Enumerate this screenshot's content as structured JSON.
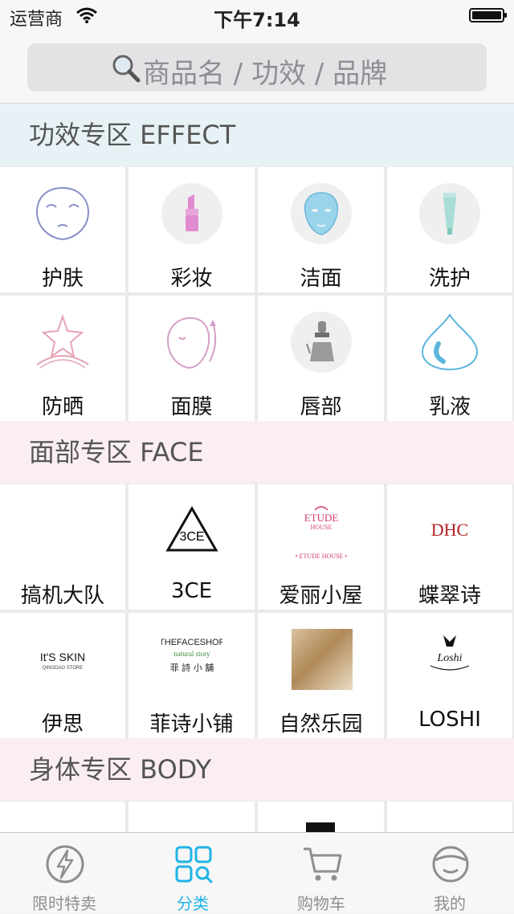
{
  "status": {
    "carrier": "运营商",
    "time": "下午7:14"
  },
  "search": {
    "placeholder": "商品名 / 功效 / 品牌"
  },
  "sections": {
    "effect": {
      "title": "功效专区 EFFECT",
      "items": [
        {
          "label": "护肤",
          "icon": "face-outline-icon"
        },
        {
          "label": "彩妆",
          "icon": "lipstick-icon"
        },
        {
          "label": "洁面",
          "icon": "face-mask-icon"
        },
        {
          "label": "洗护",
          "icon": "tube-icon"
        },
        {
          "label": "防晒",
          "icon": "star-sun-icon"
        },
        {
          "label": "面膜",
          "icon": "face-mask-outline-icon"
        },
        {
          "label": "唇部",
          "icon": "dropper-bottle-icon"
        },
        {
          "label": "乳液",
          "icon": "water-drop-icon"
        }
      ]
    },
    "face": {
      "title": "面部专区 FACE",
      "items": [
        {
          "label": "搞机大队"
        },
        {
          "label": "3CE",
          "logo_text": "3CE"
        },
        {
          "label": "爱丽小屋",
          "logo_text": "ETUDE",
          "logo_sub": "HOUSE",
          "logo_footer": "• ETUDE HOUSE •"
        },
        {
          "label": "蝶翠诗",
          "logo_text": "DHC"
        },
        {
          "label": "伊思",
          "logo_text": "It'S SKIN",
          "logo_sub": "QINGDAO STORE"
        },
        {
          "label": "菲诗小铺",
          "logo_text": "THEFACESHOP",
          "logo_sub": "natural story",
          "logo_footer": "菲 詩 小 舖"
        },
        {
          "label": "自然乐园"
        },
        {
          "label": "LOSHI",
          "logo_text": "Loshi"
        }
      ]
    },
    "body": {
      "title": "身体专区 BODY"
    }
  },
  "tabs": [
    {
      "label": "限时特卖",
      "icon": "lightning-icon",
      "active": false
    },
    {
      "label": "分类",
      "icon": "category-grid-icon",
      "active": true
    },
    {
      "label": "购物车",
      "icon": "cart-icon",
      "active": false
    },
    {
      "label": "我的",
      "icon": "profile-face-icon",
      "active": false
    }
  ],
  "colors": {
    "accent": "#1fb4e6",
    "effect_header": "#e8f2f6",
    "pink_header": "#faeef0"
  }
}
